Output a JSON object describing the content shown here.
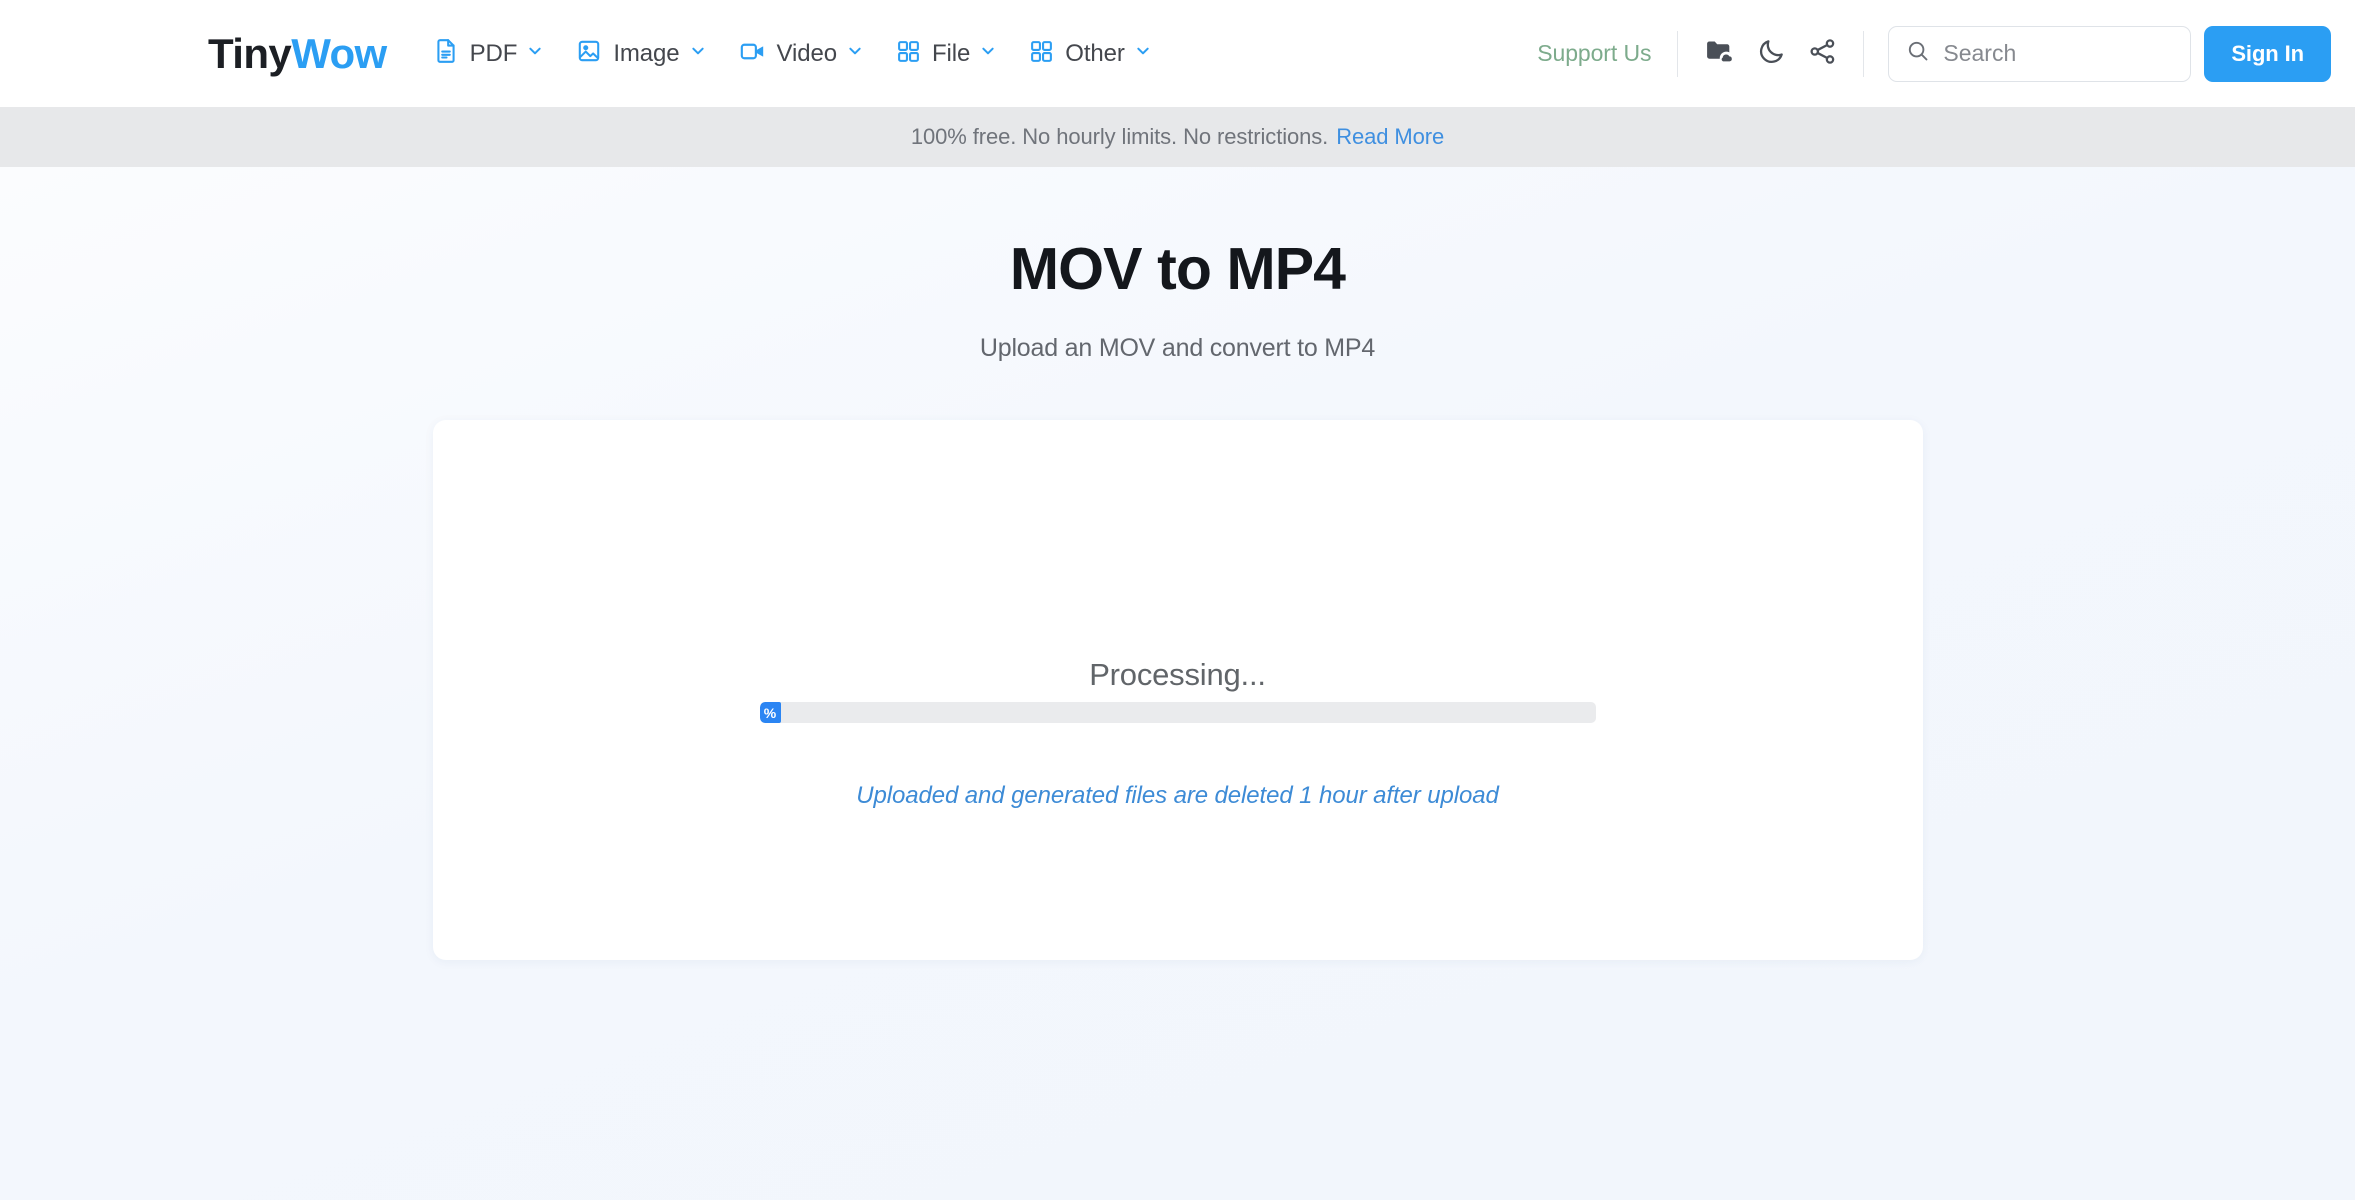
{
  "header": {
    "logo": {
      "part1": "Tiny",
      "part2": "Wow"
    },
    "nav": [
      {
        "label": "PDF",
        "icon": "pdf-document-icon",
        "chevron": "chevron-down-icon"
      },
      {
        "label": "Image",
        "icon": "image-icon",
        "chevron": "chevron-down-icon"
      },
      {
        "label": "Video",
        "icon": "video-camera-icon",
        "chevron": "chevron-down-icon"
      },
      {
        "label": "File",
        "icon": "grid-squares-icon",
        "chevron": "chevron-down-icon"
      },
      {
        "label": "Other",
        "icon": "grid-squares-icon",
        "chevron": "chevron-down-icon"
      }
    ],
    "support_us": "Support Us",
    "icons": [
      {
        "name": "folder-cloud-icon"
      },
      {
        "name": "moon-icon"
      },
      {
        "name": "share-icon"
      }
    ],
    "search": {
      "icon": "search-icon",
      "placeholder": "Search",
      "value": ""
    },
    "sign_in": "Sign In"
  },
  "notice": {
    "text": "100% free. No hourly limits. No restrictions.",
    "link": "Read More"
  },
  "main": {
    "title": "MOV to MP4",
    "subtitle": "Upload an MOV and convert to MP4",
    "status": "Processing...",
    "progress": {
      "label": "%",
      "percent": 0
    },
    "footnote": "Uploaded and generated files are deleted 1 hour after upload"
  },
  "colors": {
    "brand_blue": "#2b9ef3",
    "progress_blue": "#2b85f3",
    "support_green": "#7dab8c",
    "link_blue": "#3f8fe0",
    "footnote_blue": "#3d8bd6",
    "notice_bg": "#e7e8ea",
    "page_bg": "#f4f8fd"
  }
}
